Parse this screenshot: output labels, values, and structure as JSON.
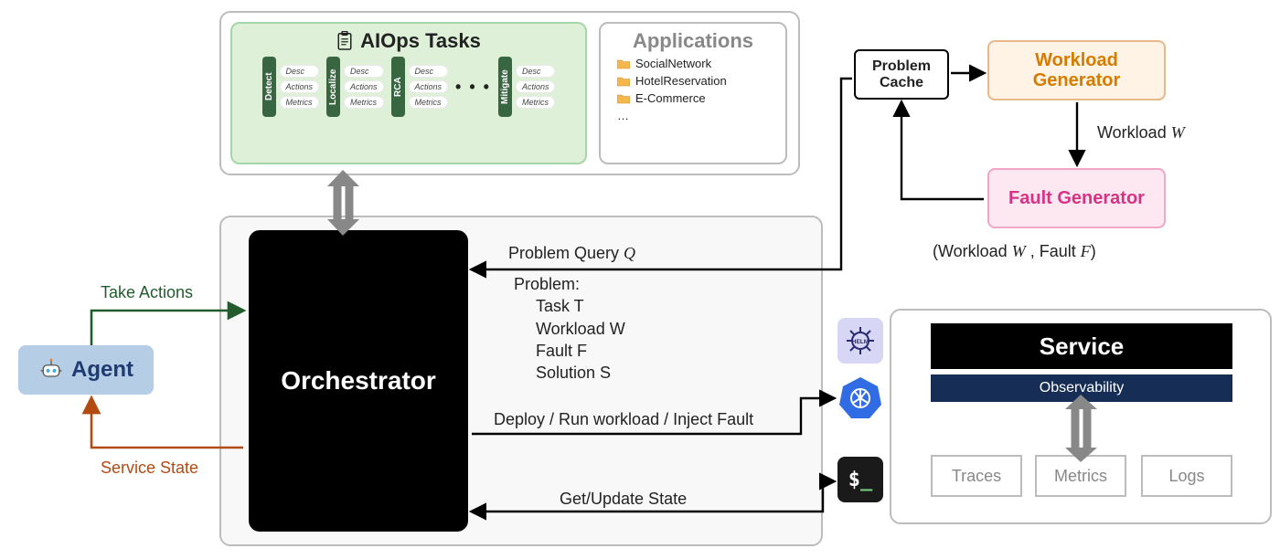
{
  "aiops": {
    "title": "AIOps Tasks",
    "tasks": [
      {
        "name": "Detect",
        "attrs": [
          "Desc",
          "Actions",
          "Metrics"
        ]
      },
      {
        "name": "Localize",
        "attrs": [
          "Desc",
          "Actions",
          "Metrics"
        ]
      },
      {
        "name": "RCA",
        "attrs": [
          "Desc",
          "Actions",
          "Metrics"
        ]
      },
      {
        "name": "Mitigate",
        "attrs": [
          "Desc",
          "Actions",
          "Metrics"
        ]
      }
    ]
  },
  "applications": {
    "title": "Applications",
    "items": [
      "SocialNetwork",
      "HotelReservation",
      "E-Commerce"
    ],
    "more": "…"
  },
  "agent": {
    "label": "Agent"
  },
  "arrows": {
    "take_actions": "Take Actions",
    "service_state": "Service State",
    "problem_query": "Problem Query ",
    "problem_query_var": "Q",
    "deploy": "Deploy / Run workload / Inject Fault",
    "get_state": "Get/Update State",
    "workload_w": "Workload ",
    "workload_w_var": "W",
    "wf_pair": "(Workload ",
    "wf_w": "W",
    "wf_mid": " , Fault ",
    "wf_f": "F",
    "wf_end": ")"
  },
  "orchestrator": {
    "label": "Orchestrator"
  },
  "problem": {
    "heading": "Problem:",
    "task": "Task T",
    "workload": "Workload W",
    "fault": "Fault F",
    "solution": "Solution S"
  },
  "boxes": {
    "problem_cache": "Problem Cache",
    "workload_gen": "Workload Generator",
    "fault_gen": "Fault Generator",
    "service": "Service",
    "observability": "Observability",
    "traces": "Traces",
    "metrics": "Metrics",
    "logs": "Logs"
  },
  "icons": {
    "helm": "HELM",
    "k8s": "kubernetes",
    "shell": "$_"
  }
}
